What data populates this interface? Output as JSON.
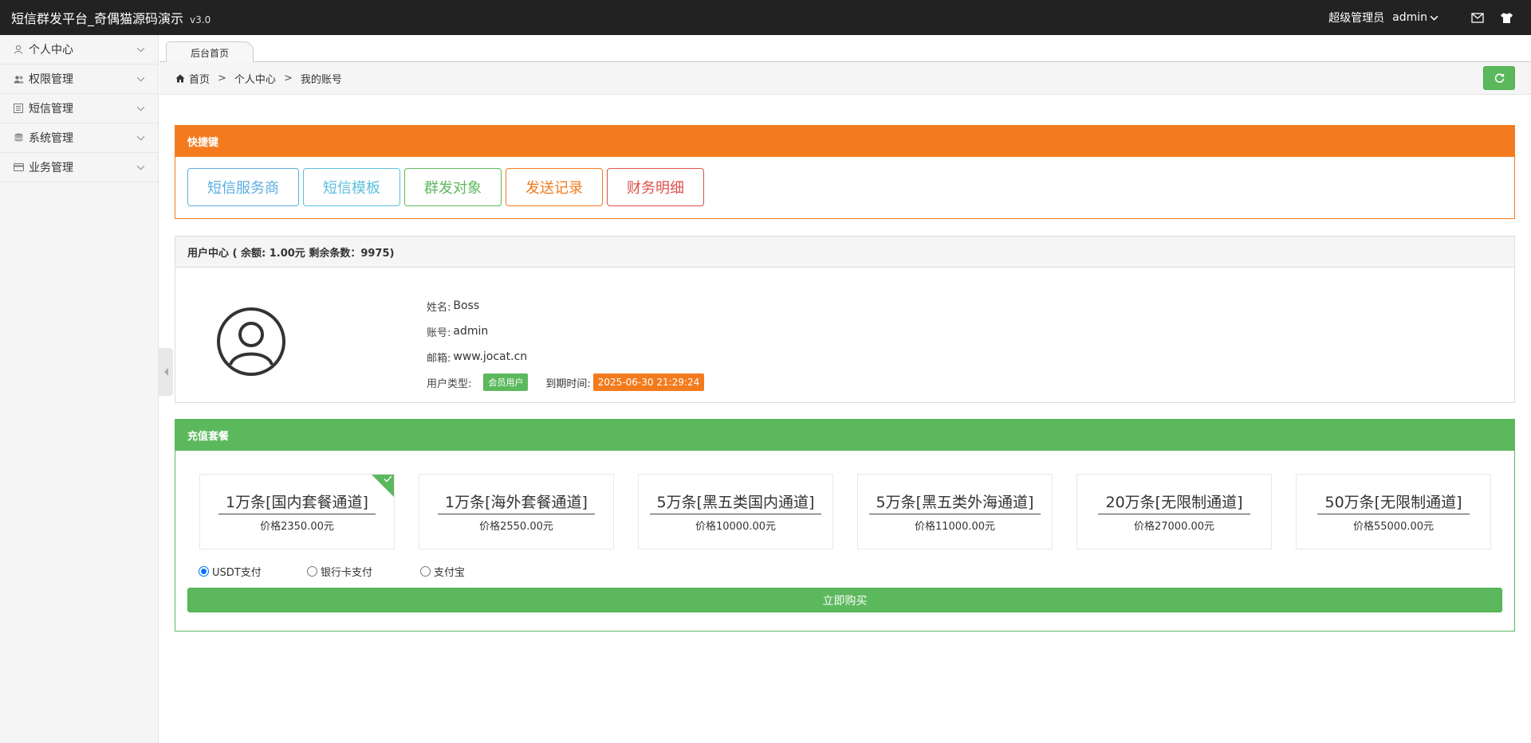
{
  "header": {
    "title": "短信群发平台_奇偶猫源码演示",
    "version": "v3.0",
    "role": "超级管理员",
    "username": "admin"
  },
  "sidebar": {
    "items": [
      {
        "label": "个人中心",
        "icon": "user-icon"
      },
      {
        "label": "权限管理",
        "icon": "users-icon"
      },
      {
        "label": "短信管理",
        "icon": "list-icon"
      },
      {
        "label": "系统管理",
        "icon": "database-icon"
      },
      {
        "label": "业务管理",
        "icon": "card-icon"
      }
    ]
  },
  "tabs": [
    {
      "label": "后台首页"
    }
  ],
  "breadcrumb": {
    "home": "首页",
    "separator": ">",
    "level1": "个人中心",
    "level2": "我的账号"
  },
  "quick": {
    "title": "快捷键",
    "buttons": [
      {
        "label": "短信服务商",
        "color": "#5bade0"
      },
      {
        "label": "短信模板",
        "color": "#5bc0de"
      },
      {
        "label": "群发对象",
        "color": "#5cb85c"
      },
      {
        "label": "发送记录",
        "color": "#f37b1d"
      },
      {
        "label": "财务明细",
        "color": "#dd514c"
      }
    ]
  },
  "user_center": {
    "title": "用户中心 ( 余额: 1.00元 剩余条数：9975)",
    "name_label": "姓名:",
    "name": "Boss",
    "account_label": "账号:",
    "account": "admin",
    "email_label": "邮箱:",
    "email": "www.jocat.cn",
    "type_label": "用户类型:",
    "type": "会员用户",
    "expire_label": "到期时间:",
    "expire": "2025-06-30 21:29:24"
  },
  "recharge": {
    "title": "充值套餐",
    "packages": [
      {
        "name": "1万条[国内套餐通道]",
        "price": "价格2350.00元",
        "selected": true
      },
      {
        "name": "1万条[海外套餐通道]",
        "price": "价格2550.00元",
        "selected": false
      },
      {
        "name": "5万条[黑五类国内通道]",
        "price": "价格10000.00元",
        "selected": false
      },
      {
        "name": "5万条[黑五类外海通道]",
        "price": "价格11000.00元",
        "selected": false
      },
      {
        "name": "20万条[无限制通道]",
        "price": "价格27000.00元",
        "selected": false
      },
      {
        "name": "50万条[无限制通道]",
        "price": "价格55000.00元",
        "selected": false
      }
    ],
    "payment_options": [
      {
        "label": "USDT支付",
        "checked": true
      },
      {
        "label": "银行卡支付",
        "checked": false
      },
      {
        "label": "支付宝",
        "checked": false
      }
    ],
    "buy_label": "立即购买"
  },
  "colors": {
    "header_bg": "#222222",
    "orange": "#f37b1d",
    "green": "#5cb85c"
  }
}
